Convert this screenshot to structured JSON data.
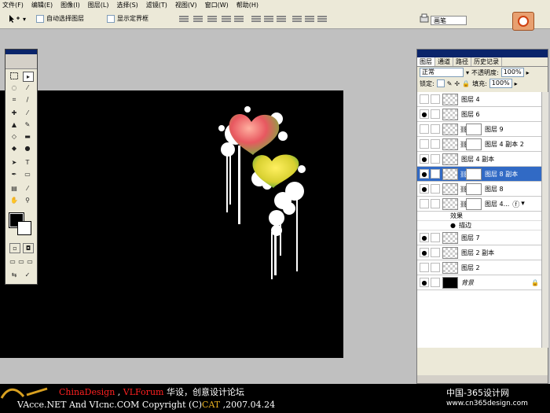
{
  "menubar": [
    "文件(F)",
    "编辑(E)",
    "图像(I)",
    "图层(L)",
    "选择(S)",
    "滤镜(T)",
    "视图(V)",
    "窗口(W)",
    "帮助(H)"
  ],
  "options": {
    "auto_select": "自动选择图层",
    "show_bounds": "显示定界框",
    "brush_tab": "画笔"
  },
  "panel": {
    "tabs": [
      "图层",
      "通道",
      "路径",
      "历史记录"
    ],
    "blend_mode": "正常",
    "opacity_label": "不透明度:",
    "opacity": "100%",
    "lock_label": "锁定:",
    "fill_label": "填充:",
    "fill": "100%"
  },
  "layers": [
    {
      "name": "图层 4",
      "visible": false,
      "mask": false
    },
    {
      "name": "图层 6",
      "visible": true,
      "mask": false
    },
    {
      "name": "图层 9",
      "visible": false,
      "mask": true
    },
    {
      "name": "图层 4 副本 2",
      "visible": false,
      "mask": true
    },
    {
      "name": "图层 4 副本",
      "visible": true,
      "mask": false
    },
    {
      "name": "图层 8 副本",
      "visible": true,
      "mask": true,
      "selected": true
    },
    {
      "name": "图层 8",
      "visible": true,
      "mask": true
    },
    {
      "name": "图层 4...",
      "visible": false,
      "mask": true,
      "fx": true
    }
  ],
  "effects": {
    "label": "效果",
    "stroke": "描边"
  },
  "layers_bottom": [
    {
      "name": "图层 7",
      "visible": true
    },
    {
      "name": "图层 2 副本",
      "visible": true
    },
    {
      "name": "图层 2",
      "visible": false
    },
    {
      "name": "背景",
      "visible": true,
      "background": true
    }
  ],
  "footer": {
    "line1_a": "ChinaDesign",
    "line1_b": " , ",
    "line1_c": "VLForum",
    "line1_d": " 华设，创意设计论坛",
    "line2_a": "VAcce.NET  And  VIcnc.COM  Copyright (C)",
    "line2_b": "CAT",
    "line2_c": " ,2007.04.24",
    "watermark1": "中国-365设计网",
    "watermark2": "www.cn365design.com"
  }
}
